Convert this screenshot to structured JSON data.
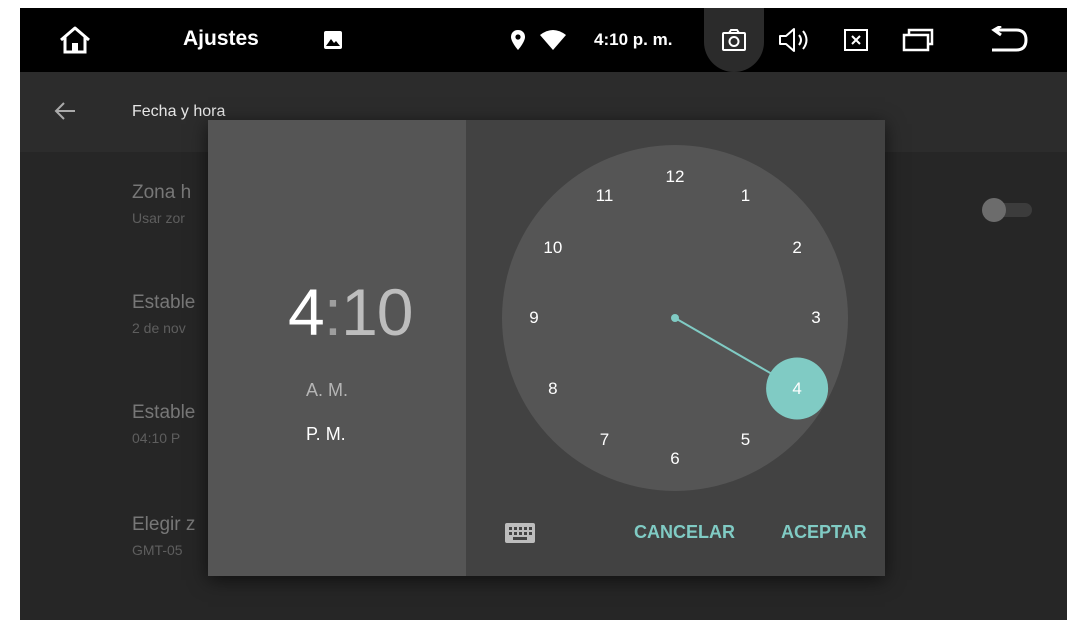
{
  "colors": {
    "accent": "#80cbc4",
    "statusbar": "#000000",
    "background": "#262626",
    "dialog": "#424242",
    "dialog_header": "#555555"
  },
  "statusbar": {
    "app_title": "Ajustes",
    "clock": "4:10 p. m.",
    "icons": [
      "home-icon",
      "image-icon",
      "location-icon",
      "wifi-icon",
      "camera-icon",
      "volume-icon",
      "close-box-icon",
      "recent-apps-icon",
      "back-icon"
    ]
  },
  "page": {
    "title": "Fecha y hora",
    "back_icon": "arrow-left-icon"
  },
  "settings": [
    {
      "title": "Zona h",
      "subtitle": "Usar zor"
    },
    {
      "title": "Estable",
      "subtitle": "2 de nov"
    },
    {
      "title": "Estable",
      "subtitle": "04:10 P"
    },
    {
      "title": "Elegir z",
      "subtitle": "GMT-05"
    }
  ],
  "dialog": {
    "hour": "4",
    "colon": ":",
    "minute": "10",
    "am": "A. M.",
    "pm": "P. M.",
    "selected_period": "P. M.",
    "selected_hour": 4,
    "dial_numbers": [
      "12",
      "1",
      "2",
      "3",
      "4",
      "5",
      "6",
      "7",
      "8",
      "9",
      "10",
      "11"
    ],
    "keyboard_icon": "keyboard-icon",
    "cancel": "CANCELAR",
    "accept": "ACEPTAR"
  }
}
